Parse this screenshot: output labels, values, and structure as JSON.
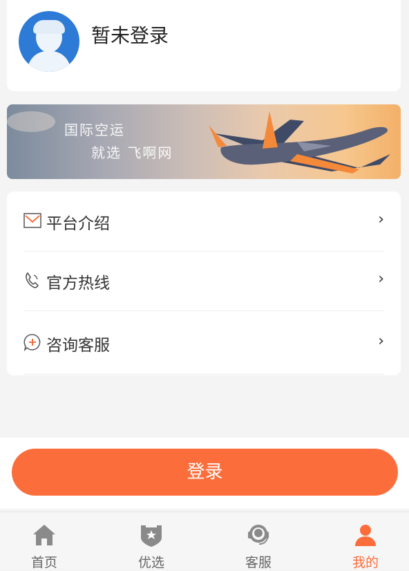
{
  "profile": {
    "username": "暂未登录"
  },
  "banner": {
    "line1": "国际空运",
    "line2": "就选 飞啊网"
  },
  "menu": [
    {
      "label": "平台介绍",
      "icon": "mail-icon",
      "chevron": "›"
    },
    {
      "label": "官方热线",
      "icon": "phone-icon",
      "chevron": "›"
    },
    {
      "label": "咨询客服",
      "icon": "chat-plus-icon",
      "chevron": "›"
    }
  ],
  "login": {
    "label": "登录"
  },
  "tabbar": [
    {
      "label": "首页",
      "icon": "home-icon"
    },
    {
      "label": "优选",
      "icon": "shield-star-icon"
    },
    {
      "label": "客服",
      "icon": "headset-icon"
    },
    {
      "label": "我的",
      "icon": "user-icon",
      "active": true
    }
  ],
  "colors": {
    "accent": "#fb6e3c",
    "avatar": "#2d7bd6",
    "tab_inactive": "#666666"
  }
}
